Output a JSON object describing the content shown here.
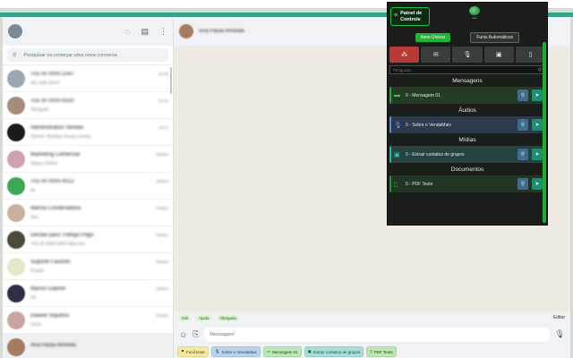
{
  "app": {
    "search_placeholder": "Pesquisar ou começar uma nova conversa",
    "chats": [
      {
        "name": "+55 00 0000-1047",
        "msg": "olá, tudo bem?",
        "time": "12:48",
        "color": "#9aa6b1"
      },
      {
        "name": "+55 00 0000-9320",
        "msg": "Obrigado",
        "time": "12:31",
        "color": "#a78c79"
      },
      {
        "name": "Administrativo Vendas",
        "msg": "Cliente: Rodrigo Souza enviou",
        "time": "10:27",
        "color": "#1b1b1b"
      },
      {
        "name": "Marketing Comercial",
        "msg": "Status Online",
        "time": "Ontem",
        "color": "#cfa3ad"
      },
      {
        "name": "+55 00 0000-4012",
        "msg": "ok",
        "time": "Ontem",
        "color": "#3aa757"
      },
      {
        "name": "Márcia Condenadora",
        "msg": "Sim",
        "time": "Ontem",
        "color": "#c8b0a0"
      },
      {
        "name": "Gestão para Tráfego Pago",
        "msg": "+55 00 0000-0000 Não tem",
        "time": "Ontem",
        "color": "#4e4a3b"
      },
      {
        "name": "Suporte Favorito",
        "msg": "Fixado",
        "time": "Ontem",
        "color": "#e6e6c8"
      },
      {
        "name": "Márcio Gabriel",
        "msg": "Ok",
        "time": "Ontem",
        "color": "#2c2f45"
      },
      {
        "name": "Daiane Siqueira",
        "msg": "Certo",
        "time": "Ontem",
        "color": "#c9a5a2"
      },
      {
        "name": "Ana Paula Almeida",
        "msg": "",
        "time": "",
        "color": "#a57b61"
      }
    ],
    "active_contact": "Ana Paula Almeida",
    "quick_replies": [
      "Olá",
      "Ajuda",
      "Obrigado"
    ],
    "edit_label": "Editar",
    "message_placeholder": "Mensagem",
    "funnel_chips": [
      {
        "label": "Funil teste",
        "kind": "funil",
        "icon": "filter-icon"
      },
      {
        "label": "Sobre o VendaMais",
        "kind": "audio",
        "icon": "mic-icon"
      },
      {
        "label": "Mensagem 01",
        "kind": "msgc",
        "icon": "message-icon"
      },
      {
        "label": "Extrair contatos de grupos",
        "kind": "midia",
        "icon": "image-icon"
      },
      {
        "label": "PDF Teste",
        "kind": "doc",
        "icon": "document-icon"
      }
    ]
  },
  "panel": {
    "control_label": "Painel de Controle",
    "tabs": [
      {
        "label": "Itens Únicos",
        "active": true
      },
      {
        "label": "Funis Automáticos",
        "active": false
      }
    ],
    "categories": [
      "funnel-icon",
      "envelope-icon",
      "mic-icon",
      "gallery-icon",
      "document-icon"
    ],
    "search_placeholder": "Pesquisar...",
    "sections": [
      {
        "title": "Mensagens",
        "item": "0 - Mensagem 01",
        "style": "green",
        "icon": "message-icon"
      },
      {
        "title": "Áudios",
        "item": "0 - Sobre o VendaMais",
        "style": "blue",
        "icon": "mic-icon"
      },
      {
        "title": "Mídias",
        "item": "0 - Extrair contatos de grupos",
        "style": "teal",
        "icon": "image-icon"
      },
      {
        "title": "Documentos",
        "item": "0 - PDF Teste",
        "style": "dgreen",
        "icon": "document-icon"
      }
    ]
  }
}
